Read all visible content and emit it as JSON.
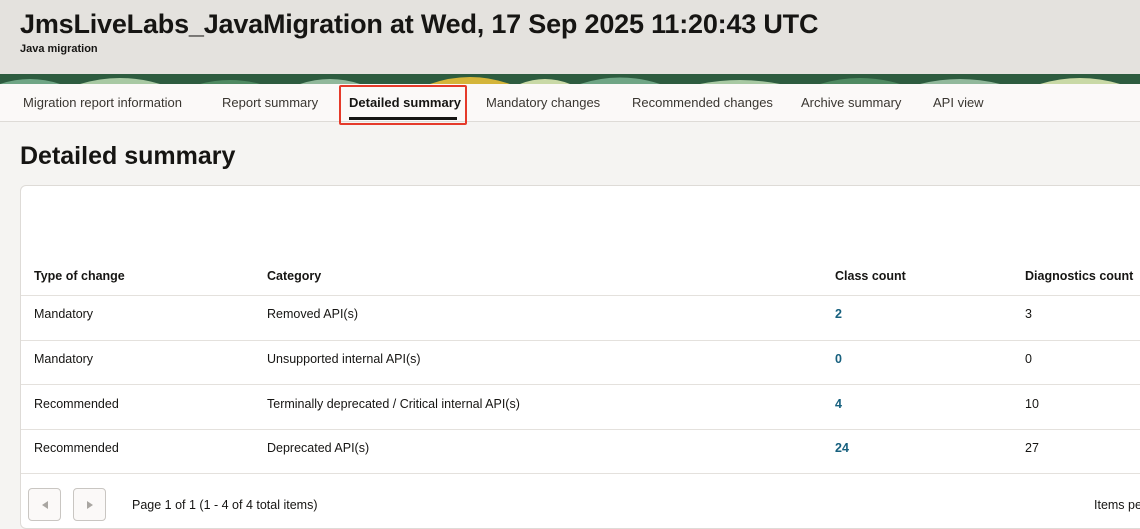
{
  "header": {
    "title": "JmsLiveLabs_JavaMigration at Wed, 17 Sep 2025 11:20:43 UTC",
    "subtitle": "Java migration"
  },
  "tabs": [
    {
      "label": "Migration report information"
    },
    {
      "label": "Report summary"
    },
    {
      "label": "Detailed summary",
      "active": true
    },
    {
      "label": "Mandatory changes"
    },
    {
      "label": "Recommended changes"
    },
    {
      "label": "Archive summary"
    },
    {
      "label": "API view"
    }
  ],
  "page_title": "Detailed summary",
  "table": {
    "columns": [
      "Type of change",
      "Category",
      "Class count",
      "Diagnostics count"
    ],
    "rows": [
      {
        "type": "Mandatory",
        "category": "Removed API(s)",
        "class_count": "2",
        "diagnostics_count": "3"
      },
      {
        "type": "Mandatory",
        "category": "Unsupported internal API(s)",
        "class_count": "0",
        "diagnostics_count": "0"
      },
      {
        "type": "Recommended",
        "category": "Terminally deprecated / Critical internal API(s)",
        "class_count": "4",
        "diagnostics_count": "10"
      },
      {
        "type": "Recommended",
        "category": "Deprecated API(s)",
        "class_count": "24",
        "diagnostics_count": "27"
      }
    ]
  },
  "pagination": {
    "summary": "Page 1 of 1 (1 - 4 of 4 total items)",
    "items_per_page_label": "Items pe"
  },
  "colors": {
    "link": "#17607e",
    "highlight": "#e53a2a",
    "header_bg": "#e4e2de",
    "band_green": "#2d5c3f",
    "band_yellow": "#d4b53a"
  },
  "icons": {
    "previous": "chevron-left-icon",
    "next": "chevron-right-icon"
  }
}
